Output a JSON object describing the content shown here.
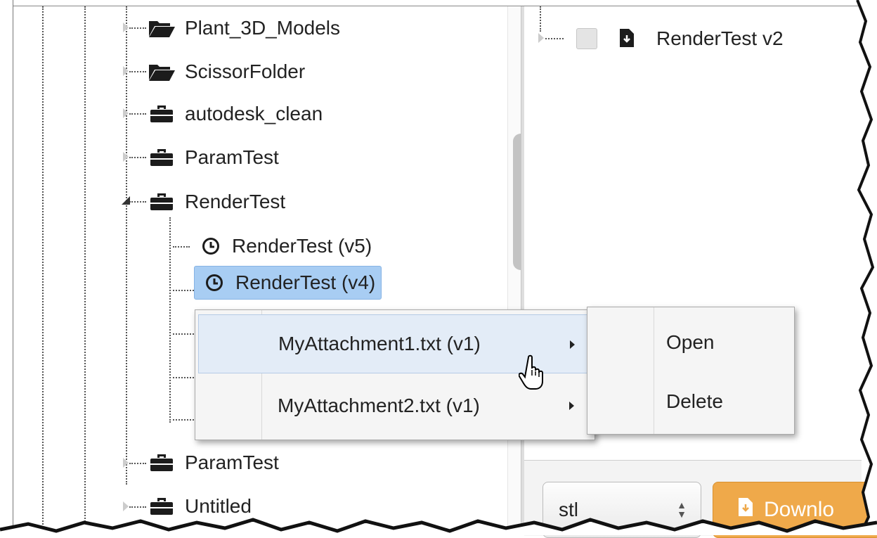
{
  "tree": {
    "items": [
      {
        "label": "Plant_3D_Models",
        "icon": "folder-open-icon"
      },
      {
        "label": "ScissorFolder",
        "icon": "folder-open-icon"
      },
      {
        "label": "autodesk_clean",
        "icon": "briefcase-icon"
      },
      {
        "label": "ParamTest",
        "icon": "briefcase-icon"
      },
      {
        "label": "RenderTest",
        "icon": "briefcase-icon"
      },
      {
        "label": "RenderTest (v5)",
        "icon": "clock-icon"
      },
      {
        "label": "RenderTest (v4)",
        "icon": "clock-icon"
      },
      {
        "label": "ParamTest",
        "icon": "briefcase-icon"
      },
      {
        "label": "Untitled",
        "icon": "briefcase-icon"
      }
    ]
  },
  "right_pane": {
    "item_label": "RenderTest v2",
    "format_value": "stl",
    "download_label": "Downlo"
  },
  "context_menu": {
    "items": [
      {
        "label": "MyAttachment1.txt (v1)"
      },
      {
        "label": "MyAttachment2.txt (v1)"
      }
    ],
    "submenu": [
      {
        "label": "Open"
      },
      {
        "label": "Delete"
      }
    ]
  },
  "colors": {
    "selected_bg": "#a8cdf3",
    "menu_hover": "#e3ecf7",
    "download_btn": "#efa94a"
  }
}
